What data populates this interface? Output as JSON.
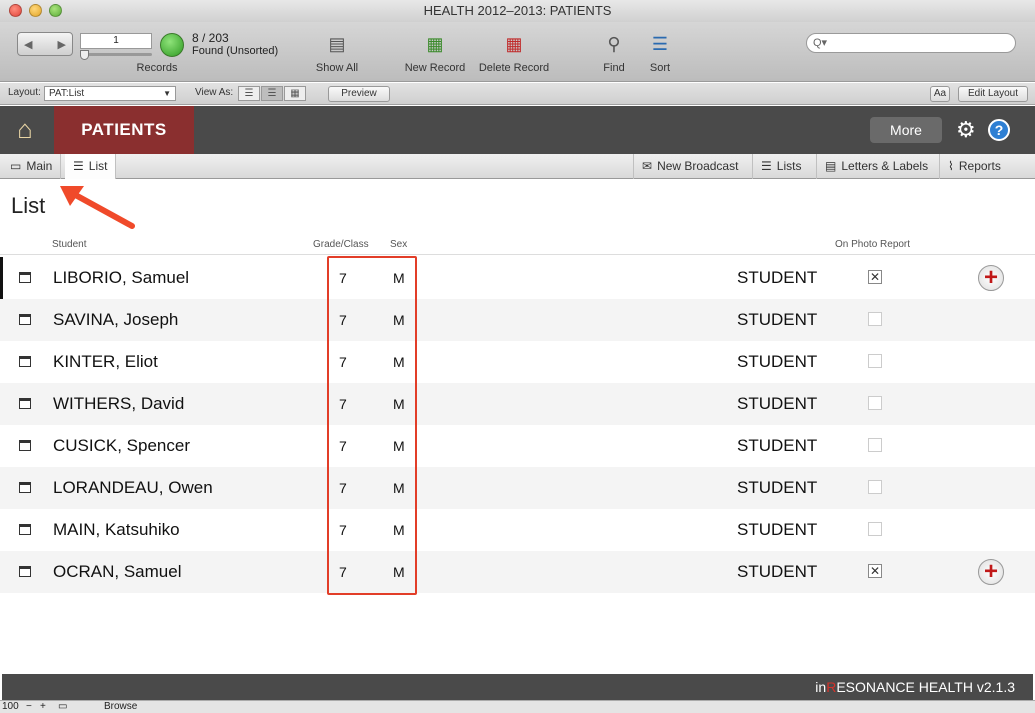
{
  "window": {
    "title": "HEALTH  2012–2013: PATIENTS"
  },
  "toolbar": {
    "record_value": "1",
    "records_label": "Records",
    "found_count": "8 / 203",
    "found_state": "Found (Unsorted)",
    "show_all": "Show All",
    "new_record": "New Record",
    "delete_record": "Delete Record",
    "find": "Find",
    "sort": "Sort",
    "search_placeholder": "Q▾"
  },
  "layoutbar": {
    "layout_label": "Layout:",
    "layout_value": "PAT:List",
    "view_as_label": "View As:",
    "preview": "Preview",
    "font_btn": "Aa",
    "edit_layout": "Edit Layout"
  },
  "header": {
    "module": "PATIENTS",
    "more": "More"
  },
  "subnav": {
    "main": "Main",
    "list": "List",
    "new_broadcast": "New Broadcast",
    "lists": "Lists",
    "letters_labels": "Letters & Labels",
    "reports": "Reports"
  },
  "page": {
    "title": "List"
  },
  "table": {
    "headers": {
      "student": "Student",
      "grade": "Grade/Class",
      "sex": "Sex",
      "photo": "On Photo Report"
    },
    "rows": [
      {
        "name": "LIBORIO, Samuel",
        "grade": "7",
        "sex": "M",
        "role": "STUDENT",
        "photo": "✕"
      },
      {
        "name": "SAVINA, Joseph",
        "grade": "7",
        "sex": "M",
        "role": "STUDENT",
        "photo": ""
      },
      {
        "name": "KINTER, Eliot",
        "grade": "7",
        "sex": "M",
        "role": "STUDENT",
        "photo": ""
      },
      {
        "name": "WITHERS, David",
        "grade": "7",
        "sex": "M",
        "role": "STUDENT",
        "photo": ""
      },
      {
        "name": "CUSICK, Spencer",
        "grade": "7",
        "sex": "M",
        "role": "STUDENT",
        "photo": ""
      },
      {
        "name": "LORANDEAU, Owen",
        "grade": "7",
        "sex": "M",
        "role": "STUDENT",
        "photo": ""
      },
      {
        "name": "MAIN, Katsuhiko",
        "grade": "7",
        "sex": "M",
        "role": "STUDENT",
        "photo": ""
      },
      {
        "name": "OCRAN, Samuel",
        "grade": "7",
        "sex": "M",
        "role": "STUDENT",
        "photo": "✕"
      }
    ]
  },
  "footer": {
    "prefix": "in",
    "accent": "R",
    "rest": "ESONANCE HEALTH v2.1.3"
  },
  "status": {
    "zoom": "100",
    "mode": "Browse"
  }
}
